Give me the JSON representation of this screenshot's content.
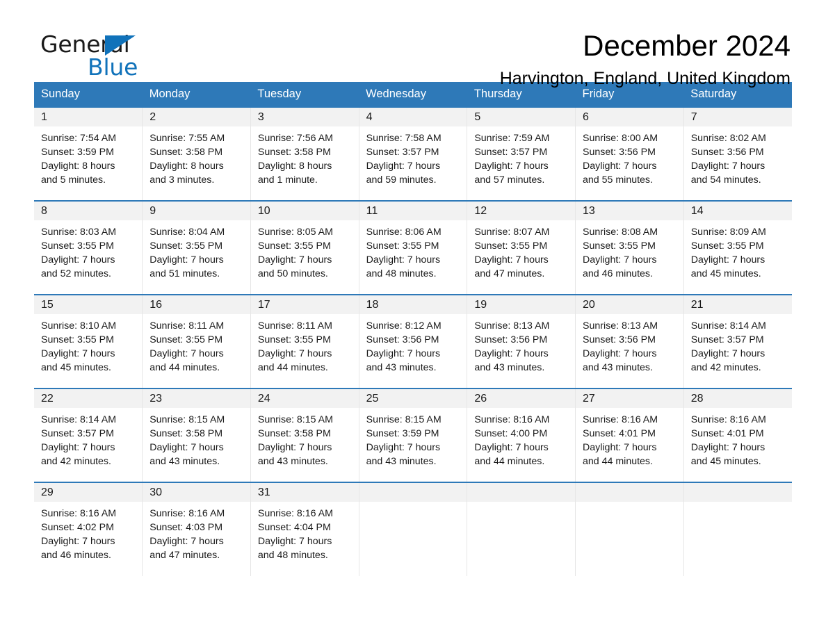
{
  "brand": {
    "name_top": "General",
    "name_bottom": "Blue",
    "color_black": "#1a1a1a",
    "color_blue": "#1072BA"
  },
  "header": {
    "title": "December 2024",
    "subtitle": "Harvington, England, United Kingdom"
  },
  "theme": {
    "header_blue": "#2E79B8",
    "daynum_band": "#F2F2F2",
    "text": "#1a1a1a"
  },
  "calendar": {
    "weekday_headers": [
      "Sunday",
      "Monday",
      "Tuesday",
      "Wednesday",
      "Thursday",
      "Friday",
      "Saturday"
    ],
    "labels": {
      "sunrise_prefix": "Sunrise:",
      "sunset_prefix": "Sunset:",
      "daylight_prefix": "Daylight:"
    },
    "weeks": [
      [
        {
          "day": "1",
          "sunrise": "Sunrise: 7:54 AM",
          "sunset": "Sunset: 3:59 PM",
          "daylight_line1": "Daylight: 8 hours",
          "daylight_line2": "and 5 minutes."
        },
        {
          "day": "2",
          "sunrise": "Sunrise: 7:55 AM",
          "sunset": "Sunset: 3:58 PM",
          "daylight_line1": "Daylight: 8 hours",
          "daylight_line2": "and 3 minutes."
        },
        {
          "day": "3",
          "sunrise": "Sunrise: 7:56 AM",
          "sunset": "Sunset: 3:58 PM",
          "daylight_line1": "Daylight: 8 hours",
          "daylight_line2": "and 1 minute."
        },
        {
          "day": "4",
          "sunrise": "Sunrise: 7:58 AM",
          "sunset": "Sunset: 3:57 PM",
          "daylight_line1": "Daylight: 7 hours",
          "daylight_line2": "and 59 minutes."
        },
        {
          "day": "5",
          "sunrise": "Sunrise: 7:59 AM",
          "sunset": "Sunset: 3:57 PM",
          "daylight_line1": "Daylight: 7 hours",
          "daylight_line2": "and 57 minutes."
        },
        {
          "day": "6",
          "sunrise": "Sunrise: 8:00 AM",
          "sunset": "Sunset: 3:56 PM",
          "daylight_line1": "Daylight: 7 hours",
          "daylight_line2": "and 55 minutes."
        },
        {
          "day": "7",
          "sunrise": "Sunrise: 8:02 AM",
          "sunset": "Sunset: 3:56 PM",
          "daylight_line1": "Daylight: 7 hours",
          "daylight_line2": "and 54 minutes."
        }
      ],
      [
        {
          "day": "8",
          "sunrise": "Sunrise: 8:03 AM",
          "sunset": "Sunset: 3:55 PM",
          "daylight_line1": "Daylight: 7 hours",
          "daylight_line2": "and 52 minutes."
        },
        {
          "day": "9",
          "sunrise": "Sunrise: 8:04 AM",
          "sunset": "Sunset: 3:55 PM",
          "daylight_line1": "Daylight: 7 hours",
          "daylight_line2": "and 51 minutes."
        },
        {
          "day": "10",
          "sunrise": "Sunrise: 8:05 AM",
          "sunset": "Sunset: 3:55 PM",
          "daylight_line1": "Daylight: 7 hours",
          "daylight_line2": "and 50 minutes."
        },
        {
          "day": "11",
          "sunrise": "Sunrise: 8:06 AM",
          "sunset": "Sunset: 3:55 PM",
          "daylight_line1": "Daylight: 7 hours",
          "daylight_line2": "and 48 minutes."
        },
        {
          "day": "12",
          "sunrise": "Sunrise: 8:07 AM",
          "sunset": "Sunset: 3:55 PM",
          "daylight_line1": "Daylight: 7 hours",
          "daylight_line2": "and 47 minutes."
        },
        {
          "day": "13",
          "sunrise": "Sunrise: 8:08 AM",
          "sunset": "Sunset: 3:55 PM",
          "daylight_line1": "Daylight: 7 hours",
          "daylight_line2": "and 46 minutes."
        },
        {
          "day": "14",
          "sunrise": "Sunrise: 8:09 AM",
          "sunset": "Sunset: 3:55 PM",
          "daylight_line1": "Daylight: 7 hours",
          "daylight_line2": "and 45 minutes."
        }
      ],
      [
        {
          "day": "15",
          "sunrise": "Sunrise: 8:10 AM",
          "sunset": "Sunset: 3:55 PM",
          "daylight_line1": "Daylight: 7 hours",
          "daylight_line2": "and 45 minutes."
        },
        {
          "day": "16",
          "sunrise": "Sunrise: 8:11 AM",
          "sunset": "Sunset: 3:55 PM",
          "daylight_line1": "Daylight: 7 hours",
          "daylight_line2": "and 44 minutes."
        },
        {
          "day": "17",
          "sunrise": "Sunrise: 8:11 AM",
          "sunset": "Sunset: 3:55 PM",
          "daylight_line1": "Daylight: 7 hours",
          "daylight_line2": "and 44 minutes."
        },
        {
          "day": "18",
          "sunrise": "Sunrise: 8:12 AM",
          "sunset": "Sunset: 3:56 PM",
          "daylight_line1": "Daylight: 7 hours",
          "daylight_line2": "and 43 minutes."
        },
        {
          "day": "19",
          "sunrise": "Sunrise: 8:13 AM",
          "sunset": "Sunset: 3:56 PM",
          "daylight_line1": "Daylight: 7 hours",
          "daylight_line2": "and 43 minutes."
        },
        {
          "day": "20",
          "sunrise": "Sunrise: 8:13 AM",
          "sunset": "Sunset: 3:56 PM",
          "daylight_line1": "Daylight: 7 hours",
          "daylight_line2": "and 43 minutes."
        },
        {
          "day": "21",
          "sunrise": "Sunrise: 8:14 AM",
          "sunset": "Sunset: 3:57 PM",
          "daylight_line1": "Daylight: 7 hours",
          "daylight_line2": "and 42 minutes."
        }
      ],
      [
        {
          "day": "22",
          "sunrise": "Sunrise: 8:14 AM",
          "sunset": "Sunset: 3:57 PM",
          "daylight_line1": "Daylight: 7 hours",
          "daylight_line2": "and 42 minutes."
        },
        {
          "day": "23",
          "sunrise": "Sunrise: 8:15 AM",
          "sunset": "Sunset: 3:58 PM",
          "daylight_line1": "Daylight: 7 hours",
          "daylight_line2": "and 43 minutes."
        },
        {
          "day": "24",
          "sunrise": "Sunrise: 8:15 AM",
          "sunset": "Sunset: 3:58 PM",
          "daylight_line1": "Daylight: 7 hours",
          "daylight_line2": "and 43 minutes."
        },
        {
          "day": "25",
          "sunrise": "Sunrise: 8:15 AM",
          "sunset": "Sunset: 3:59 PM",
          "daylight_line1": "Daylight: 7 hours",
          "daylight_line2": "and 43 minutes."
        },
        {
          "day": "26",
          "sunrise": "Sunrise: 8:16 AM",
          "sunset": "Sunset: 4:00 PM",
          "daylight_line1": "Daylight: 7 hours",
          "daylight_line2": "and 44 minutes."
        },
        {
          "day": "27",
          "sunrise": "Sunrise: 8:16 AM",
          "sunset": "Sunset: 4:01 PM",
          "daylight_line1": "Daylight: 7 hours",
          "daylight_line2": "and 44 minutes."
        },
        {
          "day": "28",
          "sunrise": "Sunrise: 8:16 AM",
          "sunset": "Sunset: 4:01 PM",
          "daylight_line1": "Daylight: 7 hours",
          "daylight_line2": "and 45 minutes."
        }
      ],
      [
        {
          "day": "29",
          "sunrise": "Sunrise: 8:16 AM",
          "sunset": "Sunset: 4:02 PM",
          "daylight_line1": "Daylight: 7 hours",
          "daylight_line2": "and 46 minutes."
        },
        {
          "day": "30",
          "sunrise": "Sunrise: 8:16 AM",
          "sunset": "Sunset: 4:03 PM",
          "daylight_line1": "Daylight: 7 hours",
          "daylight_line2": "and 47 minutes."
        },
        {
          "day": "31",
          "sunrise": "Sunrise: 8:16 AM",
          "sunset": "Sunset: 4:04 PM",
          "daylight_line1": "Daylight: 7 hours",
          "daylight_line2": "and 48 minutes."
        },
        {
          "day": "",
          "sunrise": "",
          "sunset": "",
          "daylight_line1": "",
          "daylight_line2": ""
        },
        {
          "day": "",
          "sunrise": "",
          "sunset": "",
          "daylight_line1": "",
          "daylight_line2": ""
        },
        {
          "day": "",
          "sunrise": "",
          "sunset": "",
          "daylight_line1": "",
          "daylight_line2": ""
        },
        {
          "day": "",
          "sunrise": "",
          "sunset": "",
          "daylight_line1": "",
          "daylight_line2": ""
        }
      ]
    ]
  }
}
